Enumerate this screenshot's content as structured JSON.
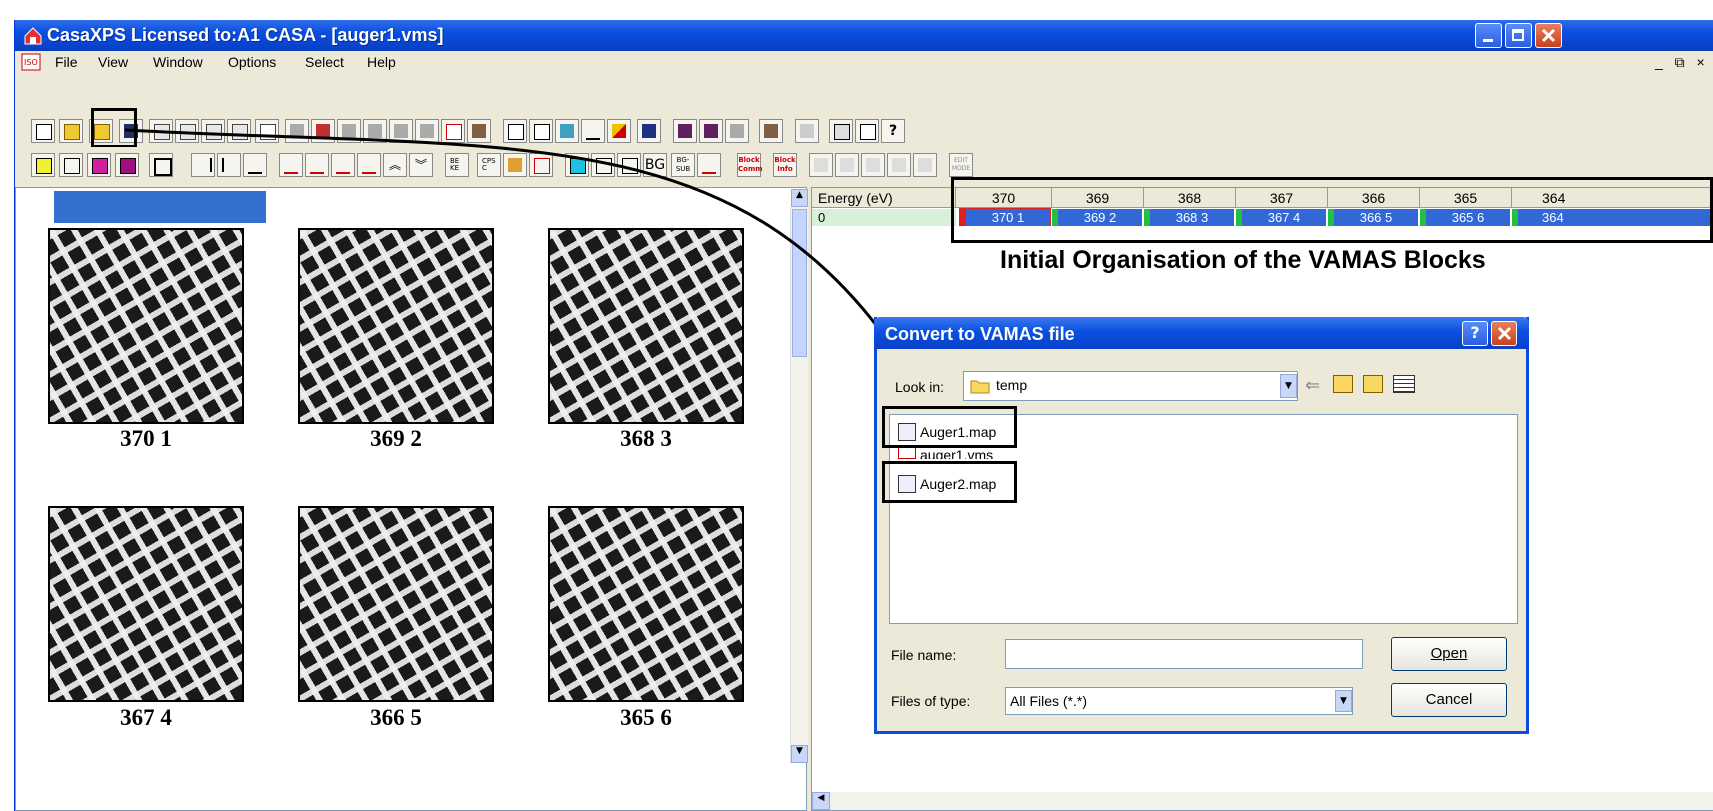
{
  "window": {
    "title": "CasaXPS Licensed to:A1 CASA - [auger1.vms]",
    "child_controls": "_ ⧉ ×"
  },
  "menu": [
    "File",
    "View",
    "Window",
    "Options",
    "Select",
    "Help"
  ],
  "toolbar2_labels": {
    "bg": "BG",
    "bgsub": "BG-SUB",
    "block_comm": "Block Comm",
    "block_info": "Block Info",
    "edit_mode": "EDIT MODE"
  },
  "images": {
    "captions": [
      "370 1",
      "369 2",
      "368 3",
      "367 4",
      "366 5",
      "365 6"
    ]
  },
  "grid": {
    "header_label": "Energy (eV)",
    "row_label": "0",
    "columns": [
      "370",
      "369",
      "368",
      "367",
      "366",
      "365",
      "364"
    ],
    "cells": [
      "370 1",
      "369 2",
      "368 3",
      "367 4",
      "366 5",
      "365 6",
      "364"
    ]
  },
  "annotation": "Initial Organisation of the VAMAS Blocks",
  "dialog": {
    "title": "Convert to VAMAS file",
    "look_in_label": "Look in:",
    "look_in_value": "temp",
    "files": [
      "Auger1.map",
      "auger1.vms",
      "Auger2.map"
    ],
    "file_name_label": "File name:",
    "file_name_value": "",
    "files_of_type_label": "Files of type:",
    "files_of_type_value": "All Files (*.*)",
    "open_label": "Open",
    "cancel_label": "Cancel"
  },
  "colors": {
    "titlebar": "#0a4ee0",
    "selection": "#3168d5",
    "window_bg": "#ece9d8"
  }
}
